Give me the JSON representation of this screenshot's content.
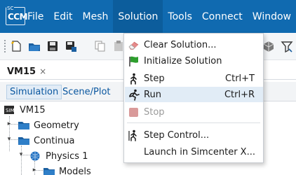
{
  "app": {
    "logo_small": "SC",
    "logo_main": "CCM"
  },
  "menubar": {
    "items": [
      {
        "label": "File"
      },
      {
        "label": "Edit"
      },
      {
        "label": "Mesh"
      },
      {
        "label": "Solution"
      },
      {
        "label": "Tools"
      },
      {
        "label": "Connect"
      },
      {
        "label": "Window"
      }
    ],
    "active": "Solution"
  },
  "tab": {
    "label": "VM15",
    "close_glyph": "×"
  },
  "panel_tabs": {
    "simulation": "Simulation",
    "scene_plot": "Scene/Plot",
    "selected": "Simulation"
  },
  "tree": {
    "root": "VM15",
    "geometry": "Geometry",
    "continua": "Continua",
    "physics": "Physics 1",
    "models": "Models"
  },
  "solution_menu": {
    "items": [
      {
        "label": "Clear Solution...",
        "shortcut": "",
        "icon": "eraser-icon",
        "enabled": true
      },
      {
        "label": "Initialize Solution",
        "shortcut": "",
        "icon": "green-flag-icon",
        "enabled": true
      },
      {
        "label": "Step",
        "shortcut": "Ctrl+T",
        "icon": "step-walker-icon",
        "enabled": true
      },
      {
        "label": "Run",
        "shortcut": "Ctrl+R",
        "icon": "run-icon",
        "enabled": true
      },
      {
        "label": "Stop",
        "shortcut": "",
        "icon": "stop-icon",
        "enabled": false
      },
      {
        "label": "Step Control...",
        "shortcut": "",
        "icon": "step-control-icon",
        "enabled": true
      },
      {
        "label": "Launch in Simcenter X...",
        "shortcut": "",
        "icon": "",
        "enabled": true
      }
    ],
    "highlighted": "Run"
  },
  "colors": {
    "menubar_bg": "#106ab0",
    "menubar_active": "#0c5d9c",
    "menu_hover": "#e1ecf6",
    "link_blue": "#0a57a0",
    "flag_green": "#2e9e2e",
    "stop_red": "#d99a9a"
  }
}
